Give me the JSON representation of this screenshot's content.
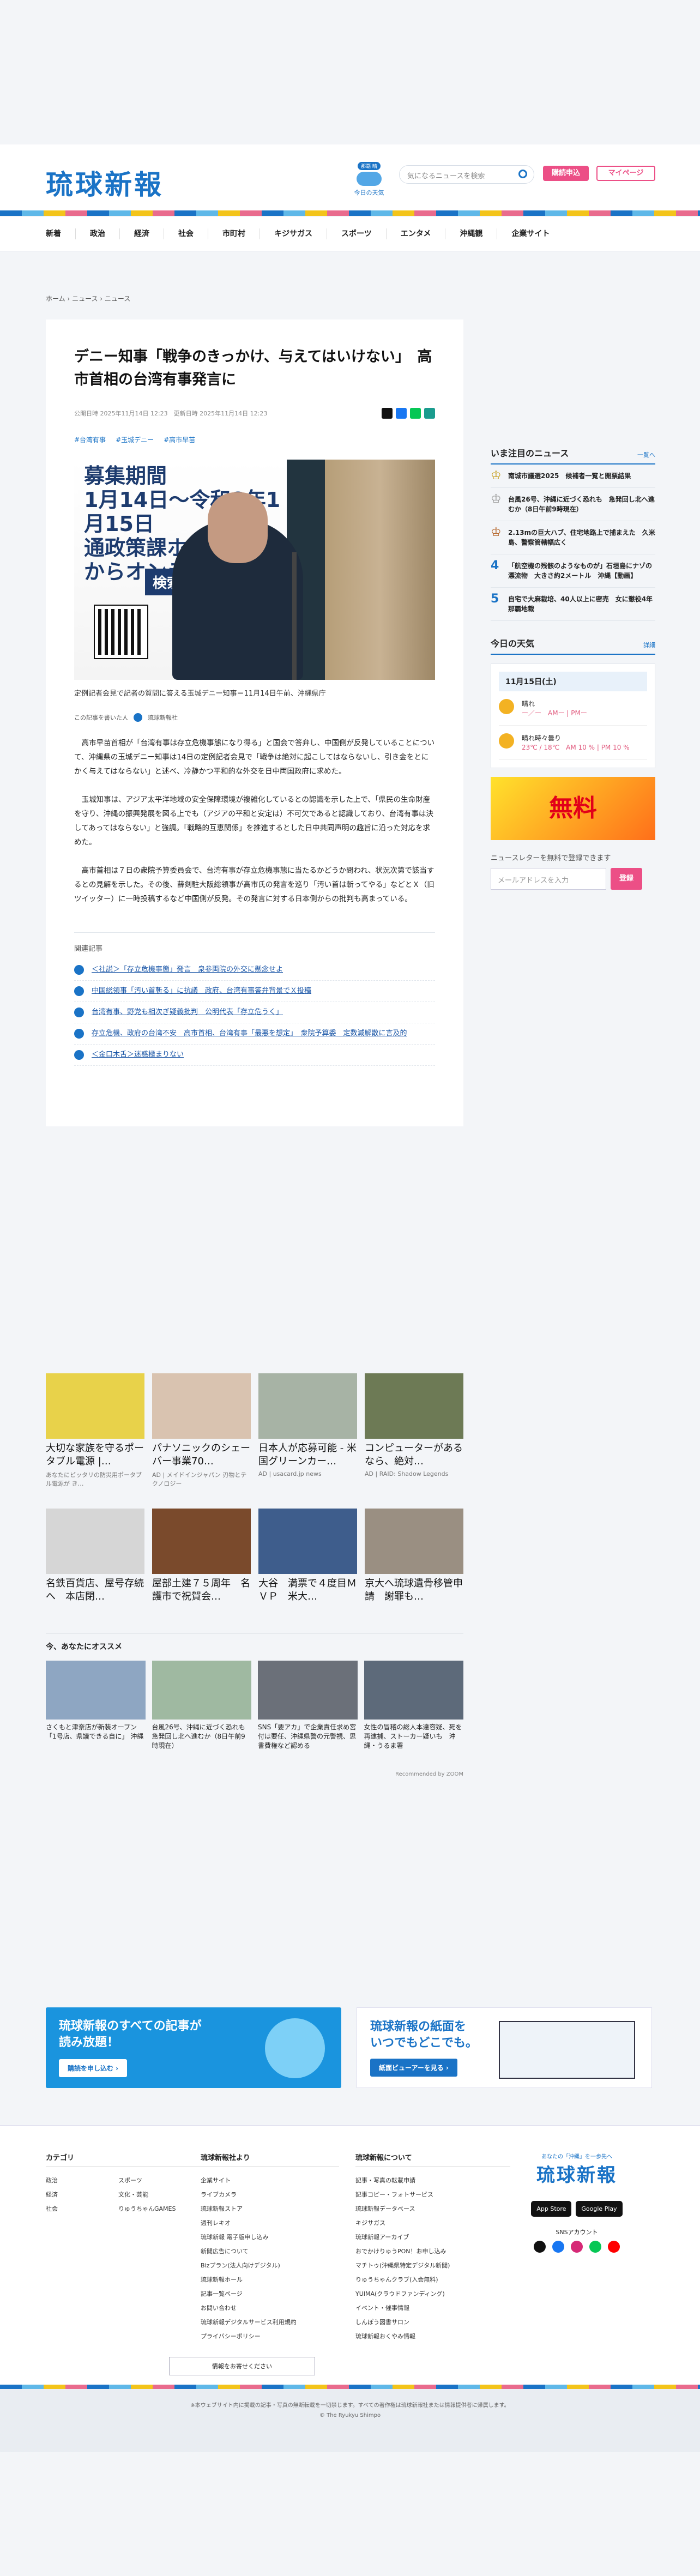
{
  "site": {
    "logo": "琉球新報"
  },
  "header": {
    "weather_caption": "今日の天気",
    "weather_badge": "那覇 晴",
    "search_placeholder": "気になるニュースを検索",
    "subscribe": "購読申込",
    "mypage": "マイページ"
  },
  "nav": [
    "新着",
    "政治",
    "経済",
    "社会",
    "市町村",
    "キジサガス",
    "スポーツ",
    "エンタメ",
    "沖縄観",
    "企業サイト"
  ],
  "breadcrumb": "ホーム › ニュース › ニュース",
  "article": {
    "title": "デニー知事「戦争のきっかけ、与えてはいけない」　高市首相の台湾有事発言に",
    "published": "公開日時 2025年11月14日 12:23　更新日時 2025年11月14日 12:23",
    "tags": [
      "#台湾有事",
      "#玉城デニー",
      "#高市早苗"
    ],
    "photo_text": "募集期間\n1月14日～令和8年1月15日\n通政策課ホームペ\nからオンライン",
    "photo_search": "検索",
    "photo_kiwame": "きわめ",
    "caption": "定例記者会見で記者の質問に答える玉城デニー知事＝11月14日午前、沖縄県庁",
    "author_label": "この記事を書いた人",
    "author": "琉球新報社",
    "paragraphs": [
      "高市早苗首相が「台湾有事は存立危機事態になり得る」と国会で答弁し、中国側が反発していることについて、沖縄県の玉城デニー知事は14日の定例記者会見で「戦争は絶対に起こしてはならないし、引き金をとにかく与えてはならない」と述べ、冷静かつ平和的な外交を日中両国政府に求めた。",
      "玉城知事は、アジア太平洋地域の安全保障環境が複雑化しているとの認識を示した上で、「県民の生命財産を守り、沖縄の振興発展を図る上でも（アジアの平和と安定は）不可欠であると認識しており、台湾有事は決してあってはならない」と強調。「戦略的互恵関係」を推進するとした日中共同声明の趣旨に沿った対応を求めた。",
      "高市首相は７日の衆院予算委員会で、台湾有事が存立危機事態に当たるかどうか問われ、状況次第で該当するとの見解を示した。その後、薛剣駐大阪総領事が高市氏の発言を巡り「汚い首は斬ってやる」などとＸ（旧ツイッター）に一時投稿するなど中国側が反発。その発言に対する日本側からの批判も高まっている。"
    ],
    "related_title": "関連記事",
    "related": [
      "＜社説＞「存立危機事態」発言　衆参両院の外交に懸念せよ",
      "中国総領事「汚い首斬る」に抗議　政府、台湾有事答弁背景でＸ投稿",
      "台湾有事、野党も相次ぎ疑義批判　公明代表「存立危うく」",
      "存立危機、政府の台湾不安　高市首相、台湾有事「最悪を想定」　衆院予算委　定数減解散に言及的",
      "＜金口木舌＞迷惑極まりない"
    ]
  },
  "sidebar": {
    "ranking_title": "いま注目のニュース",
    "more": "一覧へ",
    "ranking": [
      "南城市議選2025　候補者一覧と開票結果",
      "台風26号、沖縄に近づく恐れも　急発回し北へ進むか（8日午前9時現在）",
      "2.13mの巨大ハブ、住宅地路上で捕まえた　久米島、警察管轄幅広く",
      "「航空機の残骸のようなものが」石垣島にナゾの漂流物　大きさ約2メートル　沖縄【動画】",
      "自宅で大麻栽培、40人以上に密売　女に懲役4年　那覇地裁"
    ],
    "weather_title": "今日の天気",
    "weather_more": "詳細",
    "weather_date": "11月15日(土)",
    "weather_rows": [
      {
        "label": "晴れ",
        "temps": "ー／ー　AMー | PMー"
      },
      {
        "label": "晴れ時々曇り",
        "temps": "23℃ / 18℃　AM 10 % | PM 10 %"
      }
    ],
    "ad_text": "無料",
    "newsletter": "ニュースレターを無料で登録できます",
    "email_placeholder": "メールアドレスを入力",
    "register": "登録"
  },
  "recommend": {
    "cards": [
      {
        "title": "大切な家族を守るポータブル電源 |…",
        "source": "あなたにピッタリの防災用ポータブル電源が き…"
      },
      {
        "title": "パナソニックのシェーバー事業70…",
        "source": "AD | メイドインジャパン 刃物とテクノロジー"
      },
      {
        "title": "日本人が応募可能 - 米国グリーンカー…",
        "source": "AD | usacard.jp news"
      },
      {
        "title": "コンピューターがあるなら、絶対…",
        "source": "AD | RAID: Shadow Legends"
      },
      {
        "title": "名鉄百貨店、屋号存続へ　本店閉…",
        "source": ""
      },
      {
        "title": "屋部土建７５周年　名護市で祝賀会…",
        "source": ""
      },
      {
        "title": "大谷　満票で４度目ＭＶＰ　米大…",
        "source": ""
      },
      {
        "title": "京大へ琉球遺骨移管申請　謝罪も…",
        "source": ""
      }
    ],
    "osusume_title": "今、あなたにオススメ",
    "osusume": [
      "さくもと津奈店が新装オープン「1号店、県議できる自に」 沖縄",
      "台風26号、沖縄に近づく恐れも 急発回し北へ進むか（8日午前9時現在）",
      "SNS「要アカ」で企業責任求め宮付は要任、沖縄県警の元警視、思書費権など認める",
      "女性の冒稽の総人本達容疑、死を再逮捕、ストーカー疑いも　沖縄・うるま署"
    ],
    "powered": "Recommended by ZOOM"
  },
  "banners": {
    "b1_title": "琉球新報のすべての記事が\n読み放題！",
    "b1_button": "購読を申し込む ›",
    "b2_title": "琉球新報の紙面を\nいつでもどこでも。",
    "b2_button": "紙面ビューアーを見る ›"
  },
  "footer": {
    "col1_title": "カテゴリ",
    "col1": [
      "政治",
      "経済",
      "社会",
      "スポーツ",
      "文化・芸能",
      "りゅうちゃんGAMES"
    ],
    "col2_title": "琉球新報社より",
    "col2": [
      "企業サイト",
      "ライブカメラ",
      "琉球新報ストア",
      "週刊レキオ",
      "琉球新報 電子版申し込み",
      "新聞広告について",
      "Bizプラン(法人向けデジタル)",
      "琉球新報ホール",
      "記事一覧ページ",
      "お問い合わせ",
      "琉球新報デジタルサービス利用規約",
      "プライバシーポリシー"
    ],
    "col2_button": "情報をお寄せください",
    "col3_title": "琉球新報について",
    "col3": [
      "記事・写真の転載申請",
      "記事コピー・フォトサービス",
      "琉球新報データベース",
      "キジサガス",
      "琉球新報アーカイブ",
      "おでかけりゅうPON！お申し込み",
      "マチトゥ(沖縄県特定デジタル新聞)",
      "りゅうちゃんクラブ(入会無料)",
      "YUIMA(クラウドファンディング)",
      "イベント・催事情報",
      "しんぽう図書サロン",
      "琉球新報おくやみ情報"
    ],
    "tagline": "あなたの「沖縄」を一歩先へ",
    "flogo": "琉球新報",
    "appstore": "App Store",
    "googleplay": "Google Play",
    "sns": "SNSアカウント",
    "copyright": "※本ウェブサイト内に掲載の記事・写真の無断転載を一切禁じます。すべての著作権は琉球新報社または情報提供者に帰属します。\n© The Ryukyu Shimpo"
  }
}
